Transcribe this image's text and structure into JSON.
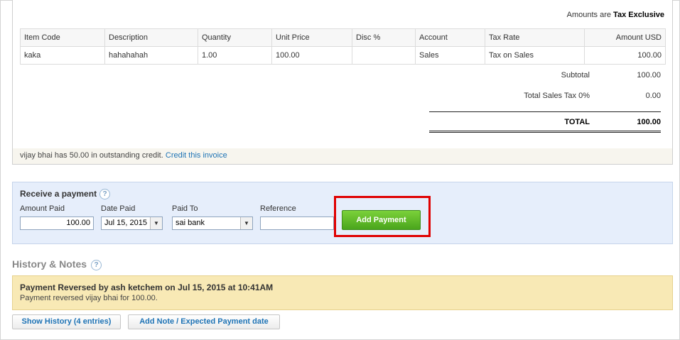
{
  "invoice": {
    "amounts_prefix": "Amounts are",
    "amounts_mode": "Tax Exclusive",
    "columns": [
      "Item Code",
      "Description",
      "Quantity",
      "Unit Price",
      "Disc %",
      "Account",
      "Tax Rate",
      "Amount USD"
    ],
    "rows": [
      [
        "kaka",
        "hahahahah",
        "1.00",
        "100.00",
        "",
        "Sales",
        "Tax on Sales",
        "100.00"
      ]
    ],
    "subtotal_label": "Subtotal",
    "subtotal_value": "100.00",
    "tax_label": "Total Sales Tax 0%",
    "tax_value": "0.00",
    "total_label": "TOTAL",
    "total_value": "100.00",
    "credit_text": "vijay bhai has 50.00 in outstanding credit.",
    "credit_link": "Credit this invoice"
  },
  "payment": {
    "title": "Receive a payment",
    "help": "?",
    "amount_label": "Amount Paid",
    "amount_value": "100.00",
    "date_label": "Date Paid",
    "date_value": "Jul 15, 2015",
    "paid_to_label": "Paid To",
    "paid_to_value": "sai bank",
    "reference_label": "Reference",
    "reference_value": "",
    "add_button": "Add Payment",
    "highlight_color": "#e00000",
    "button_color": "#5cb82a"
  },
  "history": {
    "title": "History & Notes",
    "help": "?",
    "entry_heading": "Payment Reversed by ash ketchem on Jul 15, 2015 at 10:41AM",
    "entry_body": "Payment reversed vijay bhai for 100.00.",
    "show_history": "Show History (4 entries)",
    "add_note": "Add Note / Expected Payment date"
  }
}
